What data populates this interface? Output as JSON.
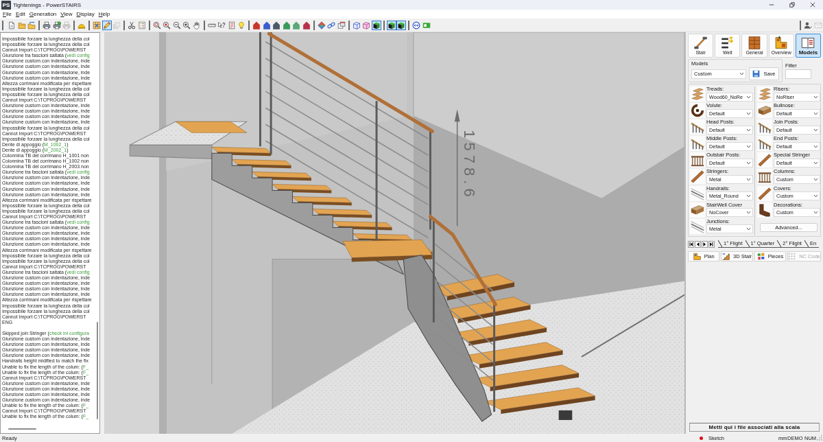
{
  "title_bar": {
    "app_icon": "PS",
    "title": "Tightenings - PowerSTAIRS"
  },
  "menu_bar": [
    "File",
    "Edit",
    "Generation",
    "View",
    "Display",
    "Help"
  ],
  "toolbar": {
    "groups": [
      [
        {
          "kind": "document",
          "selected": false,
          "disabled": false
        },
        {
          "kind": "folder",
          "selected": false,
          "disabled": false
        },
        {
          "kind": "import",
          "selected": false,
          "disabled": false
        }
      ],
      [
        {
          "kind": "printer",
          "selected": false,
          "disabled": false
        },
        {
          "kind": "preview",
          "selected": false,
          "disabled": false
        },
        {
          "kind": "printer",
          "selected": false,
          "disabled": true
        }
      ],
      [
        {
          "kind": "dome",
          "selected": false,
          "disabled": false
        }
      ],
      [
        {
          "kind": "grid",
          "selected": false,
          "disabled": false
        },
        {
          "kind": "pencil",
          "selected": true,
          "disabled": false
        },
        {
          "kind": "layers",
          "selected": false,
          "disabled": true
        }
      ],
      [
        {
          "kind": "cut",
          "selected": false,
          "disabled": false
        },
        {
          "kind": "checklist",
          "selected": false,
          "disabled": false
        }
      ],
      [
        {
          "kind": "zoomall",
          "selected": false,
          "disabled": false
        },
        {
          "kind": "zoomwindow",
          "selected": false,
          "disabled": false
        },
        {
          "kind": "zoomout",
          "selected": false,
          "disabled": false
        },
        {
          "kind": "zoomin",
          "selected": false,
          "disabled": false
        },
        {
          "kind": "hand",
          "selected": false,
          "disabled": false
        }
      ],
      [
        {
          "kind": "ruler",
          "selected": false,
          "disabled": false
        },
        {
          "kind": "help",
          "selected": false,
          "disabled": false
        },
        {
          "kind": "notes",
          "selected": false,
          "disabled": false
        },
        {
          "kind": "bulb",
          "selected": false,
          "disabled": false
        }
      ],
      [
        {
          "kind": "figure",
          "color": "#c8352b",
          "selected": false,
          "disabled": false
        },
        {
          "kind": "figure",
          "color": "#3a5fcd",
          "selected": false,
          "disabled": false
        },
        {
          "kind": "figure",
          "color": "#4a5a6a",
          "selected": false,
          "disabled": false
        },
        {
          "kind": "figure",
          "color": "#3a9a5a",
          "selected": false,
          "disabled": false
        },
        {
          "kind": "figure",
          "color": "#5aa878",
          "selected": false,
          "disabled": false
        },
        {
          "kind": "figure",
          "color": "#b8304a",
          "selected": false,
          "disabled": false
        }
      ],
      [
        {
          "kind": "orbit",
          "selected": false,
          "disabled": false
        },
        {
          "kind": "chain",
          "selected": false,
          "disabled": false
        },
        {
          "kind": "frames",
          "selected": false,
          "disabled": false
        }
      ],
      [
        {
          "kind": "wirecube",
          "selected": false,
          "disabled": false
        },
        {
          "kind": "cube",
          "selected": false,
          "disabled": false
        },
        {
          "kind": "solidcube",
          "selected": true,
          "disabled": false
        }
      ],
      [
        {
          "kind": "solidcube",
          "selected": true,
          "disabled": false
        },
        {
          "kind": "solidcube",
          "selected": true,
          "disabled": false
        }
      ],
      [
        {
          "kind": "swap",
          "selected": false,
          "disabled": false
        },
        {
          "kind": "toggle",
          "selected": false,
          "disabled": false
        }
      ]
    ],
    "right_group": [
      {
        "kind": "user",
        "selected": false,
        "disabled": false
      },
      {
        "kind": "mail",
        "selected": false,
        "disabled": true
      }
    ]
  },
  "log_panel": {
    "blocks": [
      [
        {
          "text": "Impossibile forzare la lunghezza della col"
        },
        {
          "text": "Impossibile forzare la lunghezza della col"
        },
        {
          "text": "Cannot Import C:\\TCPROG\\POWERST"
        },
        {
          "text": "Giunzione tra fascioni saltata (",
          "link": "vedi config"
        },
        {
          "text": "Giunzione custom con indentazione, inde"
        },
        {
          "text": "Giunzione custom con indentazione, inde"
        },
        {
          "text": "Giunzione custom con indentazione, inde"
        },
        {
          "text": "Giunzione custom con indentazione, inde"
        },
        {
          "text": "Altezza corrimani modificata per rispettare"
        },
        {
          "text": "Impossibile forzare la lunghezza della col"
        },
        {
          "text": "Impossibile forzare la lunghezza della col"
        },
        {
          "text": "Cannot Import C:\\TCPROG\\POWERST"
        },
        {
          "text": "Giunzione custom con indentazione, inde"
        },
        {
          "text": "Giunzione custom con indentazione, inde"
        },
        {
          "text": "Giunzione custom con indentazione, inde"
        },
        {
          "text": "Giunzione custom con indentazione, inde"
        },
        {
          "text": "Impossibile forzare la lunghezza della col"
        },
        {
          "text": "Cannot Import C:\\TCPROG\\POWERST"
        },
        {
          "text": "Impossibile forzare la lunghezza della col"
        },
        {
          "text": "Dente di appoggio (",
          "link": "M_1002_1",
          "tail": ")"
        },
        {
          "text": "Dente di appoggio (",
          "link": "M_2002_1",
          "tail": ")"
        },
        {
          "text": "Colonnina TB del corrimano H_1001 non"
        },
        {
          "text": "Colonnina TB del corrimano H_1002 non"
        },
        {
          "text": "Colonnina TB del corrimano H_2003 non"
        },
        {
          "text": "Giunzione tra fascioni saltata (",
          "link": "vedi config"
        },
        {
          "text": "Giunzione custom con indentazione, inde"
        },
        {
          "text": "Giunzione custom con indentazione, inde"
        },
        {
          "text": "Giunzione custom con indentazione, inde"
        },
        {
          "text": "Giunzione custom con indentazione, inde"
        },
        {
          "text": "Altezza corrimani modificata per rispettare"
        },
        {
          "text": "Impossibile forzare la lunghezza della col"
        },
        {
          "text": "Impossibile forzare la lunghezza della col"
        },
        {
          "text": "Cannot Import C:\\TCPROG\\POWERST"
        },
        {
          "text": "Giunzione tra fascioni saltata (",
          "link": "vedi config"
        },
        {
          "text": "Giunzione custom con indentazione, inde"
        },
        {
          "text": "Giunzione custom con indentazione, inde"
        },
        {
          "text": "Giunzione custom con indentazione, inde"
        },
        {
          "text": "Giunzione custom con indentazione, inde"
        },
        {
          "text": "Altezza corrimani modificata per rispettare"
        },
        {
          "text": "Impossibile forzare la lunghezza della col"
        },
        {
          "text": "Impossibile forzare la lunghezza della col"
        },
        {
          "text": "Cannot Import C:\\TCPROG\\POWERST"
        },
        {
          "text": "Giunzione tra fascioni saltata (",
          "link": "vedi config"
        },
        {
          "text": "Giunzione custom con indentazione, inde"
        },
        {
          "text": "Giunzione custom con indentazione, inde"
        },
        {
          "text": "Giunzione custom con indentazione, inde"
        },
        {
          "text": "Giunzione custom con indentazione, inde"
        },
        {
          "text": "Altezza corrimani modificata per rispettare"
        },
        {
          "text": "Impossibile forzare la lunghezza della col"
        },
        {
          "text": "Impossibile forzare la lunghezza della col"
        },
        {
          "text": "Cannot Import C:\\TCPROG\\POWERST"
        },
        {
          "text": "ENG"
        }
      ],
      [
        {
          "text": "Skipped join Stringer (",
          "link": "check ini configura"
        },
        {
          "text": "Giunzione custom con indentazione, inde"
        },
        {
          "text": "Giunzione custom con indentazione, inde"
        },
        {
          "text": "Giunzione custom con indentazione, inde"
        },
        {
          "text": "Giunzione custom con indentazione, inde"
        },
        {
          "text": "Handrails height midified to match the fix"
        },
        {
          "text": "Unable to fix the length of the colum: (",
          "link": "F_"
        },
        {
          "text": "Unable to fix the length of the colum: (",
          "link": "F_"
        },
        {
          "text": "Cannot Import C:\\TCPROG\\POWERST"
        },
        {
          "text": "Giunzione custom con indentazione, inde"
        },
        {
          "text": "Giunzione custom con indentazione, inde"
        },
        {
          "text": "Giunzione custom con indentazione, inde"
        },
        {
          "text": "Giunzione custom con indentazione, inde"
        },
        {
          "text": "Unable to fix the length of the colum: (",
          "link": "F_"
        },
        {
          "text": "Cannot Import C:\\TCPROG\\POWERST"
        },
        {
          "text": "Unable to fix the length of the colum: (",
          "link": "F_"
        }
      ]
    ]
  },
  "viewport": {
    "dimension": "1578.6"
  },
  "right_panel": {
    "view_tabs": [
      {
        "label": "Stair",
        "kind": "stair",
        "selected": false
      },
      {
        "label": "Well",
        "kind": "bars",
        "selected": false
      },
      {
        "label": "General",
        "kind": "cabinet",
        "selected": false
      },
      {
        "label": "Overview",
        "kind": "plan",
        "selected": false
      },
      {
        "label": "Models",
        "kind": "book",
        "selected": true
      }
    ],
    "models": {
      "label": "Models",
      "value": "Custom",
      "save": "Save",
      "filter_label": "Filter"
    },
    "components_left": [
      {
        "label": "Treads:",
        "value": "Wood60_NoRe",
        "kind": "steps"
      },
      {
        "label": "Volute:",
        "value": "Default",
        "kind": "spiral"
      },
      {
        "label": "Head Posts:",
        "value": "Default",
        "kind": "posts"
      },
      {
        "label": "Middle Posts:",
        "value": "Default",
        "kind": "posts"
      },
      {
        "label": "Outstair Posts:",
        "value": "Default",
        "kind": "fence"
      },
      {
        "label": "Stringers:",
        "value": "Metal",
        "kind": "beam"
      },
      {
        "label": "Handrails:",
        "value": "Metal_Round",
        "kind": "rail"
      },
      {
        "label": "StairWell Cover",
        "value": "NoCover",
        "kind": "slab"
      },
      {
        "label": "Junctions:",
        "value": "Metal",
        "kind": "rail"
      }
    ],
    "components_right": [
      {
        "label": "Risers:",
        "value": "NoRiser",
        "kind": "steps"
      },
      {
        "label": "Bullnose:",
        "value": "Default",
        "kind": "slab"
      },
      {
        "label": "Join Posts:",
        "value": "Default",
        "kind": "posts"
      },
      {
        "label": "End Posts:",
        "value": "Default",
        "kind": "posts"
      },
      {
        "label": "Special Stringer",
        "value": "Default",
        "kind": "beam"
      },
      {
        "label": "Columns:",
        "value": "Custom",
        "kind": "fence"
      },
      {
        "label": "Covers:",
        "value": "Custom",
        "kind": "beam"
      },
      {
        "label": "Decorations:",
        "value": "Custom",
        "kind": "bracket"
      }
    ],
    "advanced": "Advanced...",
    "sheet_tabs": [
      "1° Flight",
      "1° Quarter",
      "2° Flight",
      "En"
    ],
    "bottom_tabs": [
      {
        "label": "Plan",
        "kind": "plan",
        "disabled": false
      },
      {
        "label": "3D Stair",
        "kind": "stair",
        "disabled": false
      },
      {
        "label": "Pieces",
        "kind": "pieces",
        "disabled": false
      },
      {
        "label": "NC Code",
        "kind": "grid",
        "disabled": true
      }
    ],
    "drop_zone": "Metti qui i file associati alla scala"
  },
  "status_bar": {
    "message": "Ready",
    "panes": [
      "Sketch",
      "mm",
      "DEMO",
      "NUM"
    ]
  }
}
